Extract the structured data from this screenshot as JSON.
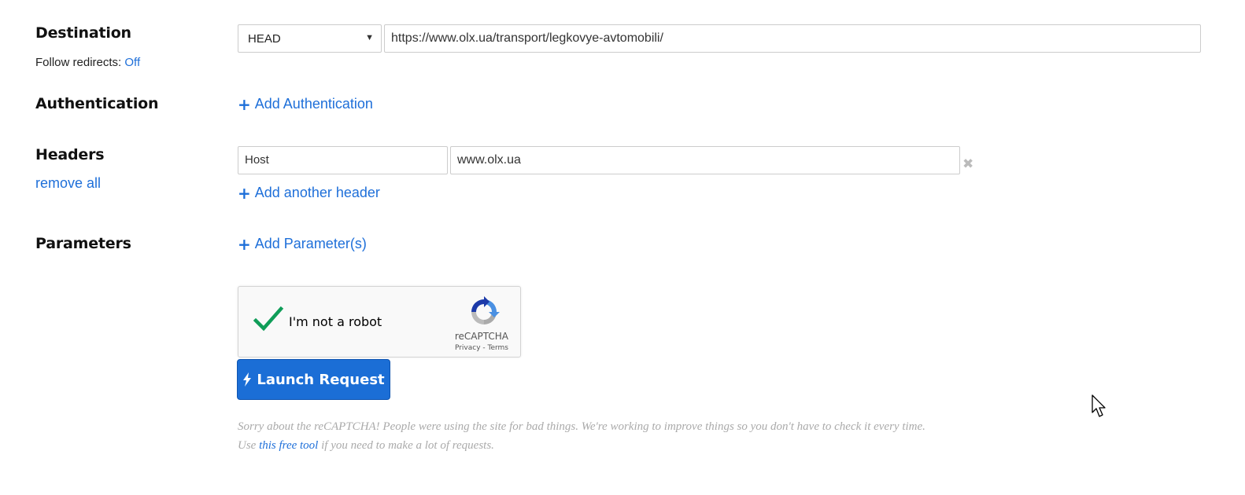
{
  "destination": {
    "label": "Destination",
    "follow_redirects_label": "Follow redirects:",
    "follow_redirects_value": "Off",
    "method": "HEAD",
    "url": "https://www.olx.ua/transport/legkovye-avtomobili/"
  },
  "authentication": {
    "label": "Authentication",
    "add_label": "Add Authentication"
  },
  "headers": {
    "label": "Headers",
    "remove_all": "remove all",
    "rows": [
      {
        "name": "Host",
        "value": "www.olx.ua"
      }
    ],
    "remove_icon": "✖",
    "add_label": "Add another header"
  },
  "parameters": {
    "label": "Parameters",
    "add_label": "Add Parameter(s)"
  },
  "captcha": {
    "label": "I'm not a robot",
    "brand": "reCAPTCHA",
    "legal": "Privacy - Terms",
    "checked": true
  },
  "launch": {
    "label": "Launch Request",
    "color": "#1b6ed6"
  },
  "note": {
    "line1": "Sorry about the reCAPTCHA! People were using the site for bad things. We're working to improve things so you don't have to check it every time.",
    "line2_prefix": "Use",
    "line2_link": "this free tool",
    "line2_suffix": "if you need to make a lot of requests."
  },
  "icons": {
    "plus": "+",
    "select_arrow": "▼"
  },
  "colors": {
    "link": "#1e6fd9",
    "check": "#0f9d58"
  }
}
